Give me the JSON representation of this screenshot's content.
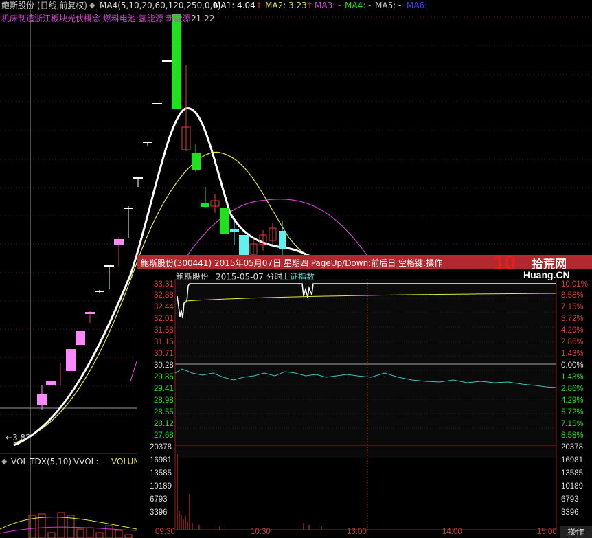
{
  "main": {
    "stock_title": "鲍斯股份 (日线,前复权)",
    "ma_label": "MA4(5,10,20,60,120,250,0,0)",
    "ma1": "MA1: 4.04",
    "ma2": "MA2: 3.23",
    "ma3": "MA3: -",
    "ma4": "MA4: -",
    "ma5": "MA5: -",
    "ma6": "MA6:",
    "concepts": "机床制造浙江板块光伏概念 燃料电池 氢能源 新能源",
    "high_label": "21.22",
    "low_label": "3.82",
    "vol_label": "VOL-TDX(5,10)",
    "vvol_label": "VVOL: -",
    "volume_label": "VOLUM",
    "colors": {
      "up": "#e23c3c",
      "down": "#20e020",
      "pink": "#ff88ff",
      "cyan": "#60f0f0",
      "ma1": "#ffffff",
      "ma2": "#e8e840",
      "ma3": "#d040d0"
    }
  },
  "popup": {
    "title": "鲍斯股份(300441) 2015年05月07日 星期四 PageUp/Down:前后日 空格键:操作",
    "sub_name": "鲍斯股份",
    "sub_date": "2015-05-07 分时",
    "sub_index": "上证指数",
    "logo_num": "10",
    "logo_cn": "拾荒网",
    "logo_url": "Huang.CN",
    "price_labels": [
      "33.31",
      "32.88",
      "32.44",
      "32.01",
      "31.58",
      "31.15",
      "30.71",
      "30.28",
      "29.85",
      "29.41",
      "28.98",
      "28.55",
      "28.12",
      "27.68"
    ],
    "pct_labels": [
      "10.01%",
      "8.58%",
      "7.15%",
      "5.72%",
      "4.29%",
      "2.86%",
      "1.43%",
      "0.00%",
      "1.43%",
      "2.86%",
      "4.29%",
      "5.72%",
      "7.15%",
      "8.58%"
    ],
    "vol_labels": [
      "20378",
      "16981",
      "13585",
      "10189",
      "6793",
      "3396"
    ],
    "time_labels": [
      "09:30",
      "10:30",
      "13:00",
      "14:00",
      "15:00"
    ],
    "op_button": "操作"
  }
}
